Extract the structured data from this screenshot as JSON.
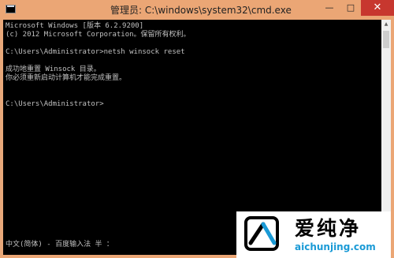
{
  "window": {
    "title": "管理员: C:\\windows\\system32\\cmd.exe",
    "minimize_glyph": "—",
    "maximize_glyph": "□",
    "close_glyph": "✕"
  },
  "console": {
    "lines": [
      "Microsoft Windows [版本 6.2.9200]",
      "(c) 2012 Microsoft Corporation。保留所有权利。",
      "",
      "C:\\Users\\Administrator>netsh winsock reset",
      "",
      "成功地重置 Winsock 目录。",
      "你必须重新启动计算机才能完成重置。",
      "",
      "",
      "C:\\Users\\Administrator>"
    ],
    "ime_status": "中文(简体) - 百度输入法 半 ："
  },
  "scrollbar": {
    "up_glyph": "▲",
    "down_glyph": "▼"
  },
  "watermark": {
    "name": "爱纯净",
    "url": "aichunjing.com"
  },
  "colors": {
    "title_bar": "#eba675",
    "close_button": "#c7372f",
    "console_bg": "#000000",
    "console_text": "#c0c0c0",
    "watermark_url": "#1a9ad6"
  }
}
